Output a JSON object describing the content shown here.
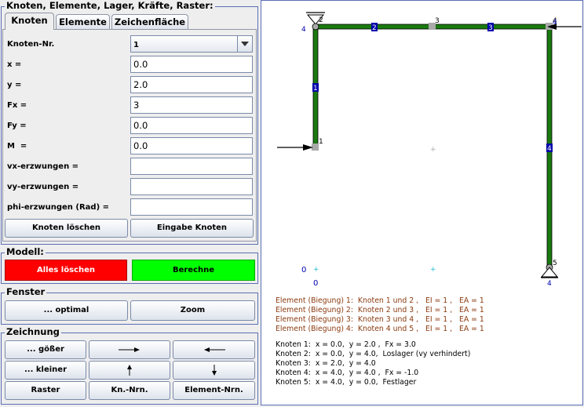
{
  "groups": {
    "input": "Knoten, Elemente, Lager, Kräfte, Raster:",
    "modell": "Modell:",
    "fenster": "Fenster",
    "zeichnung": "Zeichnung"
  },
  "tabs": [
    "Knoten",
    "Elemente",
    "Zeichenfläche"
  ],
  "form": {
    "knoten_nr_label": "Knoten-Nr.",
    "knoten_nr_value": "1",
    "x_label": "x =",
    "x_value": "0.0",
    "y_label": "y =",
    "y_value": "2.0",
    "fx_label": "Fx =",
    "fx_value": "3",
    "fy_label": "Fy =",
    "fy_value": "0.0",
    "m_label": "M  =",
    "m_value": "0.0",
    "vx_label": "vx-erzwungen =",
    "vx_value": "",
    "vy_label": "vy-erzwungen =",
    "vy_value": "",
    "phi_label": "phi-erzwungen (Rad) =",
    "phi_value": ""
  },
  "buttons": {
    "delete_node": "Knoten löschen",
    "input_node": "Eingabe Knoten",
    "delete_all": "Alles löschen",
    "compute": "Berechne",
    "optimal": "... optimal",
    "zoom": "Zoom",
    "bigger": "... gößer",
    "smaller": "... kleiner",
    "grid": "Raster",
    "node_numbers": "Kn.-Nrn.",
    "element_numbers": "Element-Nrn."
  },
  "colors": {
    "delete_all": "#ff0000",
    "compute": "#00ff00",
    "beam": "#1a7a10",
    "element_label": "#0000aa"
  },
  "canvas": {
    "node_labels": [
      "1",
      "2",
      "3",
      "4",
      "5"
    ],
    "element_labels": [
      "1",
      "2",
      "3",
      "4"
    ],
    "support_labels": [
      "4",
      "4",
      "4"
    ],
    "axis_labels": [
      "0",
      "0"
    ],
    "element_lines": [
      "Element (Biegung) 1:  Knoten 1 und 2 ,   EI = 1 ,   EA = 1",
      "Element (Biegung) 2:  Knoten 2 und 3 ,   EI = 1 ,   EA = 1",
      "Element (Biegung) 3:  Knoten 3 und 4 ,   EI = 1 ,   EA = 1",
      "Element (Biegung) 4:  Knoten 4 und 5 ,   EI = 1 ,   EA = 1"
    ],
    "node_lines": [
      "Knoten 1:  x = 0.0,  y = 2.0 ,  Fx = 3.0",
      "Knoten 2:  x = 0.0,  y = 4.0,  Loslager (vy verhindert)",
      "Knoten 3:  x = 2.0,  y = 4.0",
      "Knoten 4:  x = 4.0,  y = 4.0 ,  Fx = -1.0",
      "Knoten 5:  x = 4.0,  y = 0.0,  Festlager"
    ]
  }
}
